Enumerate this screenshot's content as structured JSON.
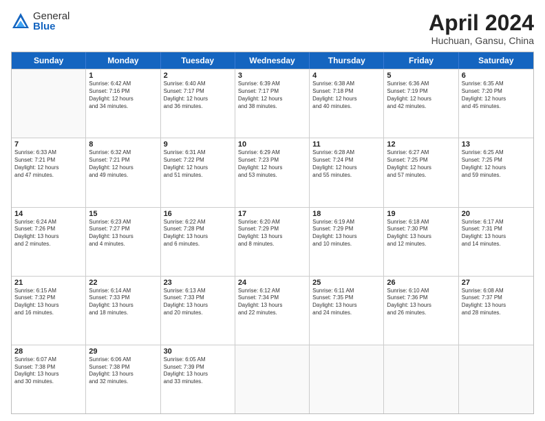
{
  "header": {
    "logo_general": "General",
    "logo_blue": "Blue",
    "month_title": "April 2024",
    "location": "Huchuan, Gansu, China"
  },
  "weekdays": [
    "Sunday",
    "Monday",
    "Tuesday",
    "Wednesday",
    "Thursday",
    "Friday",
    "Saturday"
  ],
  "rows": [
    [
      {
        "day": "",
        "info": ""
      },
      {
        "day": "1",
        "info": "Sunrise: 6:42 AM\nSunset: 7:16 PM\nDaylight: 12 hours\nand 34 minutes."
      },
      {
        "day": "2",
        "info": "Sunrise: 6:40 AM\nSunset: 7:17 PM\nDaylight: 12 hours\nand 36 minutes."
      },
      {
        "day": "3",
        "info": "Sunrise: 6:39 AM\nSunset: 7:17 PM\nDaylight: 12 hours\nand 38 minutes."
      },
      {
        "day": "4",
        "info": "Sunrise: 6:38 AM\nSunset: 7:18 PM\nDaylight: 12 hours\nand 40 minutes."
      },
      {
        "day": "5",
        "info": "Sunrise: 6:36 AM\nSunset: 7:19 PM\nDaylight: 12 hours\nand 42 minutes."
      },
      {
        "day": "6",
        "info": "Sunrise: 6:35 AM\nSunset: 7:20 PM\nDaylight: 12 hours\nand 45 minutes."
      }
    ],
    [
      {
        "day": "7",
        "info": "Sunrise: 6:33 AM\nSunset: 7:21 PM\nDaylight: 12 hours\nand 47 minutes."
      },
      {
        "day": "8",
        "info": "Sunrise: 6:32 AM\nSunset: 7:21 PM\nDaylight: 12 hours\nand 49 minutes."
      },
      {
        "day": "9",
        "info": "Sunrise: 6:31 AM\nSunset: 7:22 PM\nDaylight: 12 hours\nand 51 minutes."
      },
      {
        "day": "10",
        "info": "Sunrise: 6:29 AM\nSunset: 7:23 PM\nDaylight: 12 hours\nand 53 minutes."
      },
      {
        "day": "11",
        "info": "Sunrise: 6:28 AM\nSunset: 7:24 PM\nDaylight: 12 hours\nand 55 minutes."
      },
      {
        "day": "12",
        "info": "Sunrise: 6:27 AM\nSunset: 7:25 PM\nDaylight: 12 hours\nand 57 minutes."
      },
      {
        "day": "13",
        "info": "Sunrise: 6:25 AM\nSunset: 7:25 PM\nDaylight: 12 hours\nand 59 minutes."
      }
    ],
    [
      {
        "day": "14",
        "info": "Sunrise: 6:24 AM\nSunset: 7:26 PM\nDaylight: 13 hours\nand 2 minutes."
      },
      {
        "day": "15",
        "info": "Sunrise: 6:23 AM\nSunset: 7:27 PM\nDaylight: 13 hours\nand 4 minutes."
      },
      {
        "day": "16",
        "info": "Sunrise: 6:22 AM\nSunset: 7:28 PM\nDaylight: 13 hours\nand 6 minutes."
      },
      {
        "day": "17",
        "info": "Sunrise: 6:20 AM\nSunset: 7:29 PM\nDaylight: 13 hours\nand 8 minutes."
      },
      {
        "day": "18",
        "info": "Sunrise: 6:19 AM\nSunset: 7:29 PM\nDaylight: 13 hours\nand 10 minutes."
      },
      {
        "day": "19",
        "info": "Sunrise: 6:18 AM\nSunset: 7:30 PM\nDaylight: 13 hours\nand 12 minutes."
      },
      {
        "day": "20",
        "info": "Sunrise: 6:17 AM\nSunset: 7:31 PM\nDaylight: 13 hours\nand 14 minutes."
      }
    ],
    [
      {
        "day": "21",
        "info": "Sunrise: 6:15 AM\nSunset: 7:32 PM\nDaylight: 13 hours\nand 16 minutes."
      },
      {
        "day": "22",
        "info": "Sunrise: 6:14 AM\nSunset: 7:33 PM\nDaylight: 13 hours\nand 18 minutes."
      },
      {
        "day": "23",
        "info": "Sunrise: 6:13 AM\nSunset: 7:33 PM\nDaylight: 13 hours\nand 20 minutes."
      },
      {
        "day": "24",
        "info": "Sunrise: 6:12 AM\nSunset: 7:34 PM\nDaylight: 13 hours\nand 22 minutes."
      },
      {
        "day": "25",
        "info": "Sunrise: 6:11 AM\nSunset: 7:35 PM\nDaylight: 13 hours\nand 24 minutes."
      },
      {
        "day": "26",
        "info": "Sunrise: 6:10 AM\nSunset: 7:36 PM\nDaylight: 13 hours\nand 26 minutes."
      },
      {
        "day": "27",
        "info": "Sunrise: 6:08 AM\nSunset: 7:37 PM\nDaylight: 13 hours\nand 28 minutes."
      }
    ],
    [
      {
        "day": "28",
        "info": "Sunrise: 6:07 AM\nSunset: 7:38 PM\nDaylight: 13 hours\nand 30 minutes."
      },
      {
        "day": "29",
        "info": "Sunrise: 6:06 AM\nSunset: 7:38 PM\nDaylight: 13 hours\nand 32 minutes."
      },
      {
        "day": "30",
        "info": "Sunrise: 6:05 AM\nSunset: 7:39 PM\nDaylight: 13 hours\nand 33 minutes."
      },
      {
        "day": "",
        "info": ""
      },
      {
        "day": "",
        "info": ""
      },
      {
        "day": "",
        "info": ""
      },
      {
        "day": "",
        "info": ""
      }
    ]
  ]
}
